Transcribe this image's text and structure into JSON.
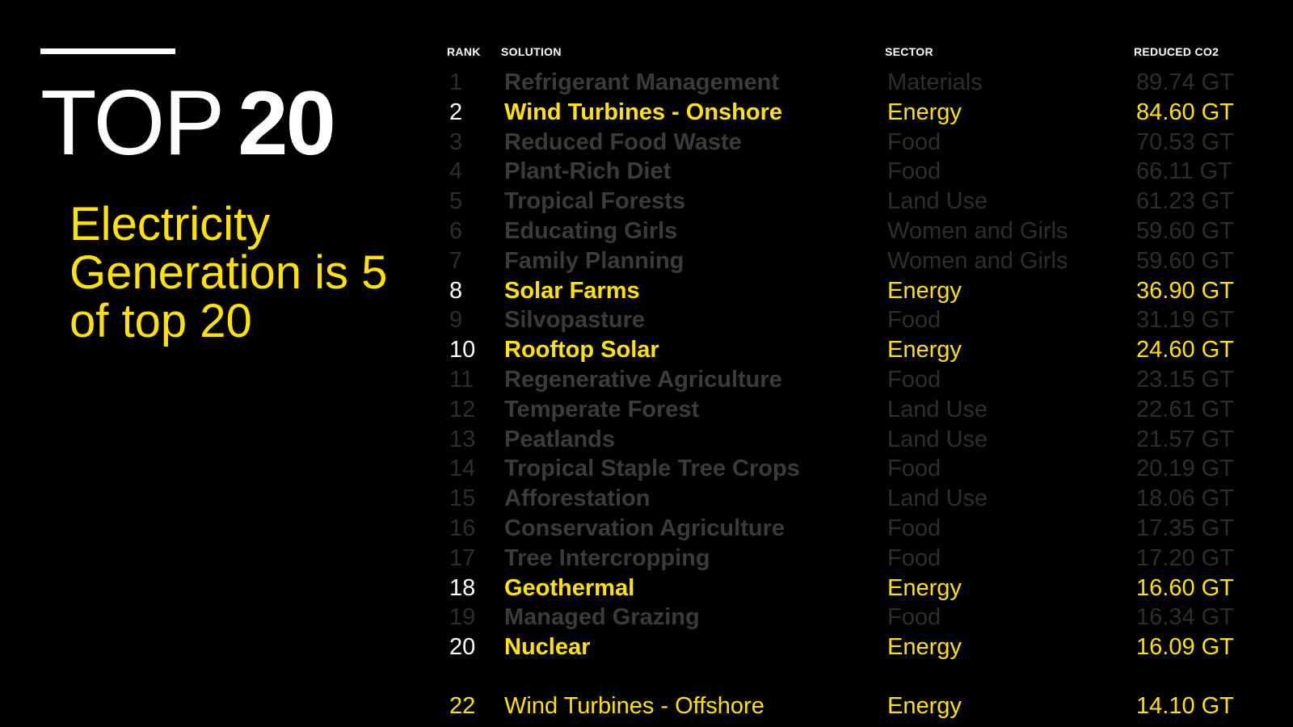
{
  "slide": {
    "title_light": "TOP",
    "title_bold": "20",
    "subtitle": "Electricity Generation is 5 of top 20"
  },
  "table": {
    "headers": {
      "rank": "RANK",
      "solution": "SOLUTION",
      "sector": "SECTOR",
      "reduced": "REDUCED CO2"
    },
    "rows": [
      {
        "rank": "1",
        "solution": "Refrigerant Management",
        "sector": "Materials",
        "reduced": "89.74 GT",
        "highlight": false
      },
      {
        "rank": "2",
        "solution": "Wind Turbines - Onshore",
        "sector": "Energy",
        "reduced": "84.60 GT",
        "highlight": true
      },
      {
        "rank": "3",
        "solution": "Reduced Food Waste",
        "sector": "Food",
        "reduced": "70.53 GT",
        "highlight": false
      },
      {
        "rank": "4",
        "solution": "Plant-Rich Diet",
        "sector": "Food",
        "reduced": "66.11 GT",
        "highlight": false
      },
      {
        "rank": "5",
        "solution": "Tropical Forests",
        "sector": "Land Use",
        "reduced": "61.23 GT",
        "highlight": false
      },
      {
        "rank": "6",
        "solution": "Educating Girls",
        "sector": "Women and Girls",
        "reduced": "59.60 GT",
        "highlight": false
      },
      {
        "rank": "7",
        "solution": "Family Planning",
        "sector": "Women and Girls",
        "reduced": "59.60 GT",
        "highlight": false
      },
      {
        "rank": "8",
        "solution": "Solar Farms",
        "sector": "Energy",
        "reduced": "36.90 GT",
        "highlight": true
      },
      {
        "rank": "9",
        "solution": "Silvopasture",
        "sector": "Food",
        "reduced": "31.19 GT",
        "highlight": false
      },
      {
        "rank": "10",
        "solution": "Rooftop Solar",
        "sector": "Energy",
        "reduced": "24.60 GT",
        "highlight": true
      },
      {
        "rank": "11",
        "solution": "Regenerative Agriculture",
        "sector": "Food",
        "reduced": "23.15 GT",
        "highlight": false
      },
      {
        "rank": "12",
        "solution": "Temperate Forest",
        "sector": "Land Use",
        "reduced": "22.61 GT",
        "highlight": false
      },
      {
        "rank": "13",
        "solution": "Peatlands",
        "sector": "Land Use",
        "reduced": "21.57 GT",
        "highlight": false
      },
      {
        "rank": "14",
        "solution": "Tropical Staple Tree Crops",
        "sector": "Food",
        "reduced": "20.19 GT",
        "highlight": false
      },
      {
        "rank": "15",
        "solution": "Afforestation",
        "sector": "Land Use",
        "reduced": "18.06 GT",
        "highlight": false
      },
      {
        "rank": "16",
        "solution": "Conservation Agriculture",
        "sector": "Food",
        "reduced": "17.35 GT",
        "highlight": false
      },
      {
        "rank": "17",
        "solution": "Tree Intercropping",
        "sector": "Food",
        "reduced": "17.20 GT",
        "highlight": false
      },
      {
        "rank": "18",
        "solution": "Geothermal",
        "sector": "Energy",
        "reduced": "16.60 GT",
        "highlight": true
      },
      {
        "rank": "19",
        "solution": "Managed Grazing",
        "sector": "Food",
        "reduced": "16.34 GT",
        "highlight": false
      },
      {
        "rank": "20",
        "solution": "Nuclear",
        "sector": "Energy",
        "reduced": "16.09 GT",
        "highlight": true
      }
    ],
    "extra_row": {
      "rank": "22",
      "solution": "Wind Turbines - Offshore",
      "sector": "Energy",
      "reduced": "14.10 GT"
    }
  },
  "colors": {
    "background": "#000000",
    "highlight": "#ffe200",
    "dimmed": "#3b3b3b",
    "text": "#ffffff"
  }
}
